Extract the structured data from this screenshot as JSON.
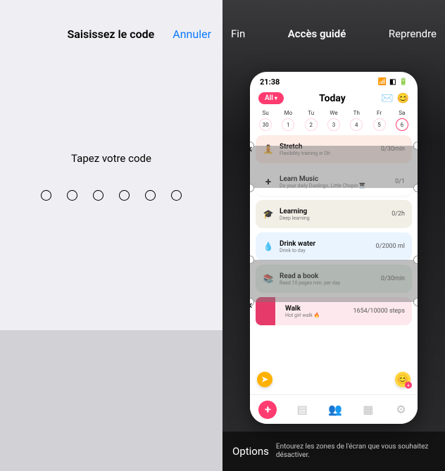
{
  "left": {
    "title": "Saisissez le code",
    "cancel": "Annuler",
    "prompt": "Tapez votre code",
    "digits": 6
  },
  "right": {
    "end": "Fin",
    "title": "Accès guidé",
    "resume": "Reprendre",
    "options": "Options",
    "footnote": "Entourez les zones de l'écran que vous souhaitez désactiver."
  },
  "phone": {
    "time": "21:38",
    "all": "All",
    "today": "Today",
    "header_icons": {
      "mail": "mail-icon",
      "emoji": "emoji-icon"
    },
    "wifi_icon": "wifi-icon",
    "battery_icon": "battery-icon",
    "signal_icon": "signal-icon",
    "days": [
      {
        "abbr": "Su",
        "num": "30"
      },
      {
        "abbr": "Mo",
        "num": "1"
      },
      {
        "abbr": "Tu",
        "num": "2"
      },
      {
        "abbr": "We",
        "num": "3"
      },
      {
        "abbr": "Th",
        "num": "4"
      },
      {
        "abbr": "Fr",
        "num": "5"
      },
      {
        "abbr": "Sa",
        "num": "6",
        "selected": true
      }
    ],
    "cards": {
      "stretch": {
        "title": "Stretch",
        "sub": "Flexibility training in Oh",
        "meta": "0/30min"
      },
      "learnmusic": {
        "title": "Learn Music",
        "sub": "Do your daily Duolingo, Little Chopin 🎹",
        "meta": "0/1"
      },
      "learning": {
        "title": "Learning",
        "sub": "Deep learning",
        "meta": "0/2h"
      },
      "water": {
        "title": "Drink water",
        "sub": "Drink to day",
        "meta": "0/2000 ml"
      },
      "book": {
        "title": "Read a book",
        "sub": "Read 10 pages min. per day",
        "meta": "0/30min"
      },
      "walk": {
        "title": "Walk",
        "sub": "Hot girl walk 🔥",
        "meta": "1654/10000 steps"
      }
    },
    "tabs": {
      "add": "add-fab",
      "today": "today-tab",
      "social": "social-tab",
      "stats": "stats-tab",
      "settings": "settings-tab"
    }
  }
}
